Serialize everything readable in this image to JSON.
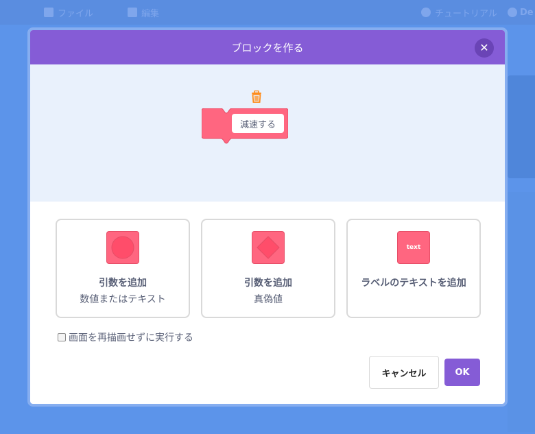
{
  "background": {
    "menu_items": [
      "ファイル",
      "編集"
    ],
    "tutorial_label": "チュートリアル",
    "dev_label": "De"
  },
  "modal": {
    "title": "ブロックを作る",
    "close_icon": "close-icon",
    "block_name": "減速する",
    "trash_icon": "trash-icon",
    "options": [
      {
        "title": "引数を追加",
        "subtitle": "数値またはテキスト",
        "icon": "round-input-icon"
      },
      {
        "title": "引数を追加",
        "subtitle": "真偽値",
        "icon": "boolean-input-icon"
      },
      {
        "title": "ラベルのテキストを追加",
        "subtitle": "",
        "icon": "label-text-icon",
        "icon_text": "text"
      }
    ],
    "run_without_refresh_label": "画面を再描画せずに実行する",
    "run_without_refresh_checked": false,
    "cancel_label": "キャンセル",
    "ok_label": "OK"
  },
  "colors": {
    "header": "#855cd6",
    "block": "#ff6680",
    "preview_bg": "#e9f1fc",
    "ok_button": "#855cd6"
  }
}
